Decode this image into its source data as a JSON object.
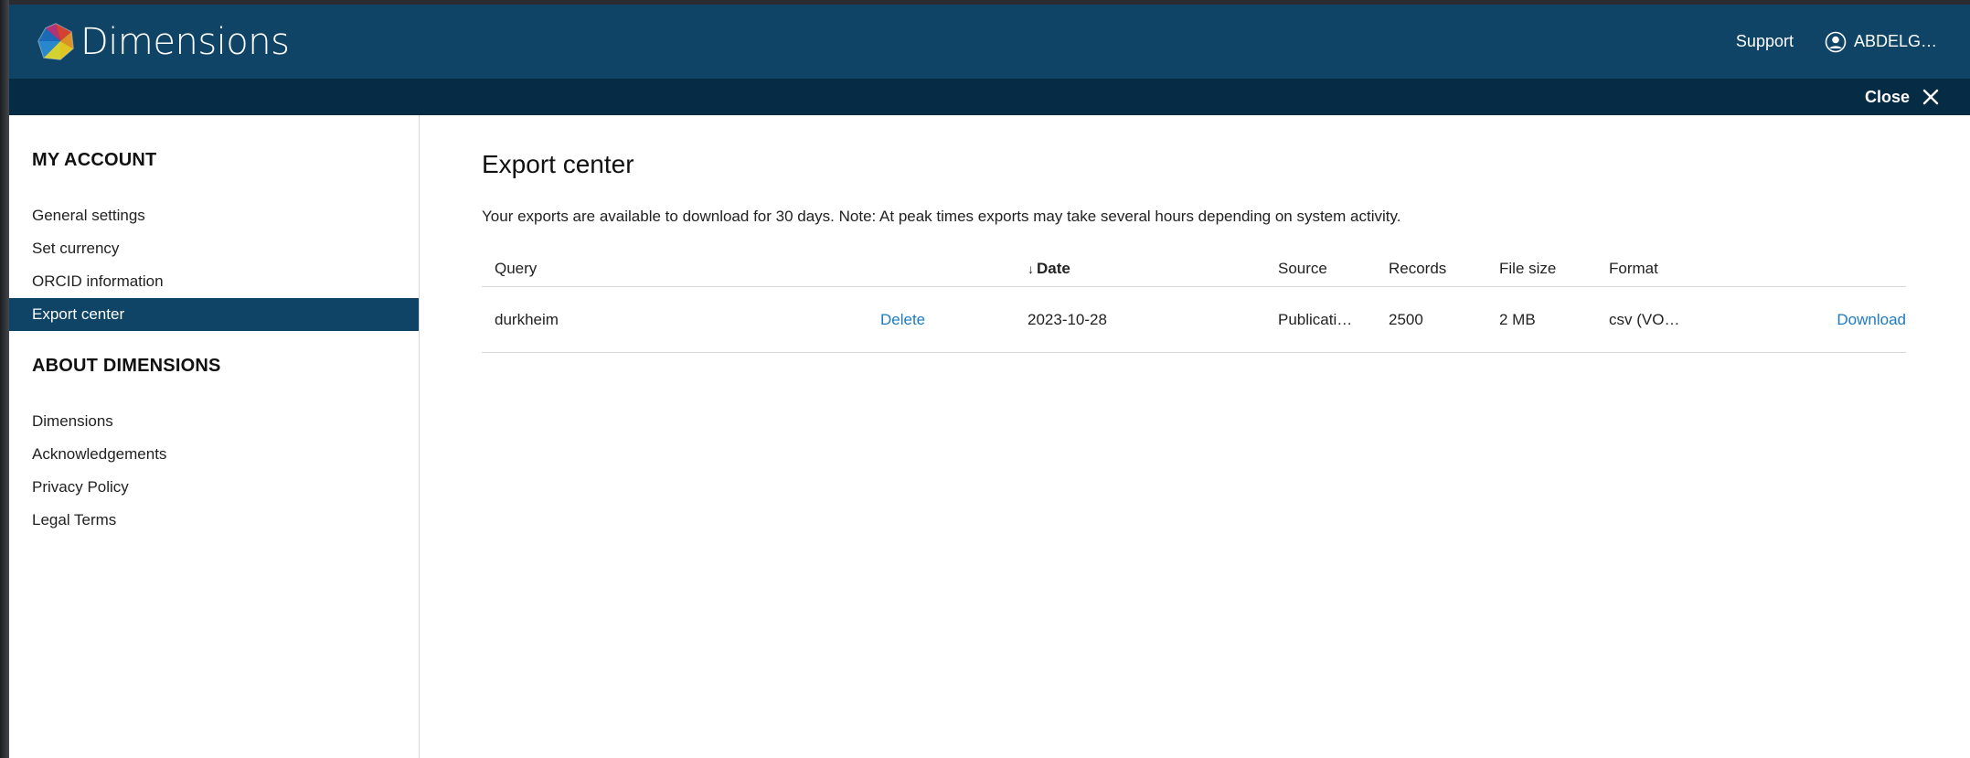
{
  "header": {
    "brand": "Dimensions",
    "support_label": "Support",
    "user_label": "ABDELG…"
  },
  "subbar": {
    "close_label": "Close"
  },
  "sidebar": {
    "sections": [
      {
        "heading": "MY ACCOUNT",
        "items": [
          {
            "label": "General settings"
          },
          {
            "label": "Set currency"
          },
          {
            "label": "ORCID information"
          },
          {
            "label": "Export center",
            "active": true
          }
        ]
      },
      {
        "heading": "ABOUT DIMENSIONS",
        "items": [
          {
            "label": "Dimensions"
          },
          {
            "label": "Acknowledgements"
          },
          {
            "label": "Privacy Policy"
          },
          {
            "label": "Legal Terms"
          }
        ]
      }
    ]
  },
  "main": {
    "title": "Export center",
    "notice": "Your exports are available to download for 30 days. Note: At peak times exports may take several hours depending on system activity.",
    "table": {
      "columns": {
        "query": "Query",
        "date": "Date",
        "source": "Source",
        "records": "Records",
        "file_size": "File size",
        "format": "Format"
      },
      "sort_indicator": "↓",
      "rows": [
        {
          "query": "durkheim",
          "delete_label": "Delete",
          "date": "2023-10-28",
          "source": "Publicati…",
          "records": "2500",
          "file_size": "2 MB",
          "format": "csv (VO…",
          "download_label": "Download"
        }
      ]
    }
  },
  "colors": {
    "header_bg": "#0f4467",
    "subbar_bg": "#052b45",
    "active_item_bg": "#0f4467",
    "link": "#1e7bc2"
  }
}
